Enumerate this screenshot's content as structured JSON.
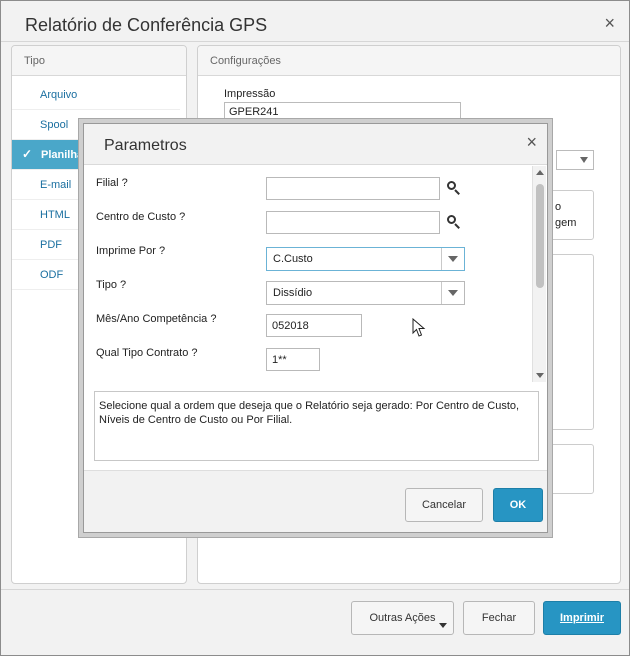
{
  "window": {
    "title": "Relatório de Conferência GPS",
    "close_glyph": "×"
  },
  "tipo_panel": {
    "header": "Tipo",
    "items": [
      {
        "label": "Arquivo"
      },
      {
        "label": "Spool"
      },
      {
        "label": "Planilha",
        "selected": true
      },
      {
        "label": "E-mail"
      },
      {
        "label": "HTML"
      },
      {
        "label": "PDF"
      },
      {
        "label": "ODF"
      }
    ]
  },
  "config_panel": {
    "header": "Configurações",
    "impressao_label": "Impressão",
    "impressao_value": "GPER241",
    "partial_text_1": "o",
    "partial_text_2": "gem"
  },
  "footer": {
    "outras_acoes": "Outras Ações",
    "fechar": "Fechar",
    "imprimir": "Imprimir"
  },
  "dialog": {
    "title": "Parametros",
    "close_glyph": "×",
    "params": {
      "filial_label": "Filial ?",
      "filial_value": "",
      "centro_label": "Centro de Custo ?",
      "centro_value": "",
      "imprime_label": "Imprime Por ?",
      "imprime_value": "C.Custo",
      "tipo_label": "Tipo ?",
      "tipo_value": "Dissídio",
      "mes_label": "Mês/Ano Competência ?",
      "mes_value": "052018",
      "contrato_label": "Qual Tipo Contrato ?",
      "contrato_value": "1**"
    },
    "help_text": "Selecione qual a ordem que deseja que o Relatório seja gerado: Por Centro de Custo, Níveis de Centro de Custo ou Por Filial.",
    "cancel": "Cancelar",
    "ok": "OK"
  },
  "colors": {
    "accent": "#2795c3",
    "selected_item": "#4aa7c9",
    "link": "#1a6fa0"
  }
}
